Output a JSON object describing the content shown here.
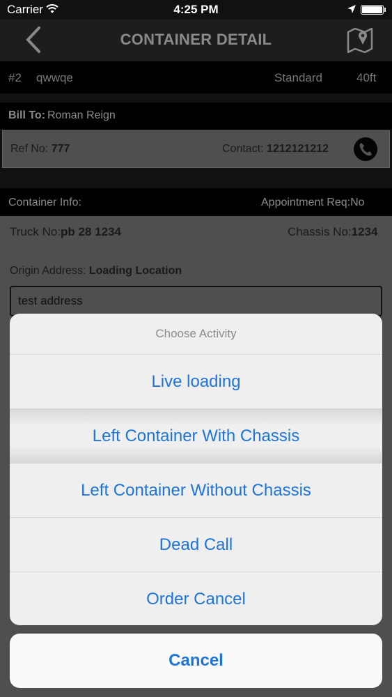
{
  "status_bar": {
    "carrier": "Carrier",
    "time": "4:25 PM"
  },
  "nav": {
    "title": "CONTAINER DETAIL"
  },
  "container": {
    "number": "#2",
    "name": "qwwqe",
    "type": "Standard",
    "size": "40ft"
  },
  "bill_to": {
    "label": "Bill To:",
    "value": "Roman Reign"
  },
  "ref": {
    "label": "Ref No:",
    "value": "777"
  },
  "contact": {
    "label": "Contact:",
    "value": "1212121212"
  },
  "container_info": {
    "label": "Container Info:",
    "appointment": "Appointment Req:No"
  },
  "truck": {
    "label": "Truck No:",
    "value": "pb 28 1234"
  },
  "chassis": {
    "label": "Chassis No:",
    "value": "1234"
  },
  "origin": {
    "label": "Origin Address:",
    "value": "Loading Location",
    "address": "test address"
  },
  "action_sheet": {
    "title": "Choose Activity",
    "options": [
      "Live loading",
      "Left Container With Chassis",
      "Left Container Without Chassis",
      "Dead Call",
      "Order Cancel"
    ],
    "cancel": "Cancel"
  },
  "colors": {
    "accent": "#1e74d8",
    "sheet_bg": "#efefef",
    "overlay_bg": "#4f4f4f"
  }
}
